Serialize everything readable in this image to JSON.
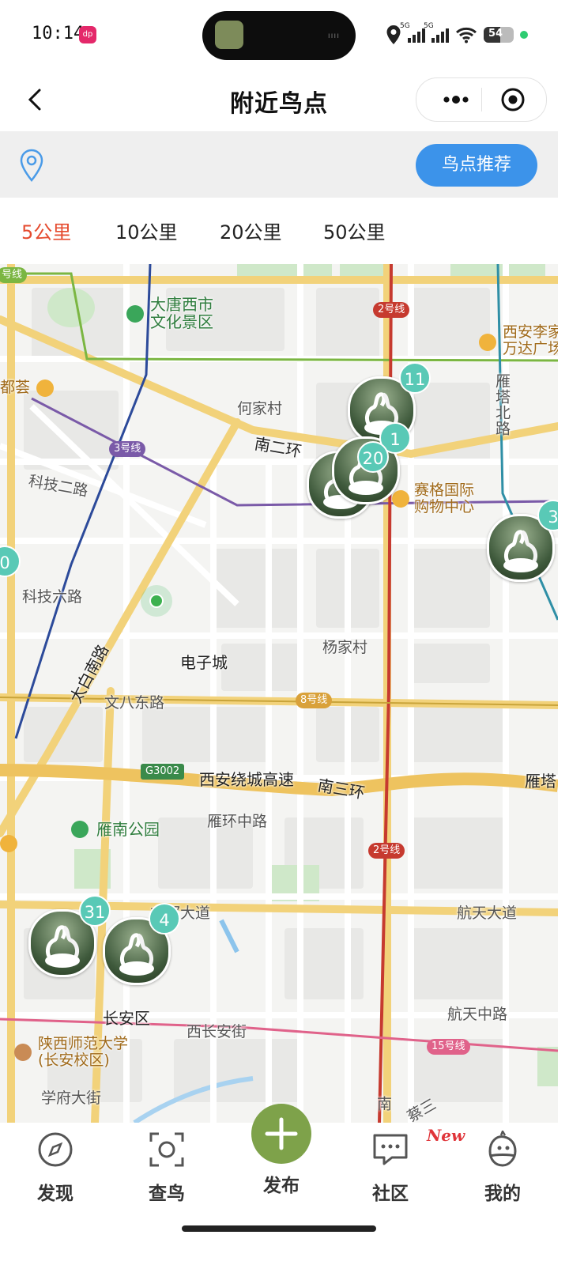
{
  "status": {
    "time": "10:14",
    "app_badge": "dp",
    "battery": "54",
    "net1": "5G",
    "net2": "5G"
  },
  "header": {
    "title": "附近鸟点"
  },
  "locbar": {
    "recommend_label": "鸟点推荐"
  },
  "tabs": [
    {
      "label": "5公里",
      "active": true
    },
    {
      "label": "10公里",
      "active": false
    },
    {
      "label": "20公里",
      "active": false
    },
    {
      "label": "50公里",
      "active": false
    }
  ],
  "map": {
    "labels": {
      "datang": "大唐西市\n文化景区",
      "wanda": "西安李家\n万达广场",
      "dufu": "都荟",
      "hejia": "何家村",
      "nan2": "南二环",
      "yanta_north": "雁塔北路",
      "keji2": "科技二路",
      "saige": "赛格国际\n购物中心",
      "keji6": "科技六路",
      "yangjia": "杨家村",
      "dianzi": "电子城",
      "taibai": "太白南路",
      "wenba": "文八东路",
      "raocheng": "西安绕城高速",
      "nan3": "南三环",
      "yanta": "雁塔",
      "yannan": "雁南公园",
      "yanhuan": "雁环中路",
      "gudu": "古都大道",
      "hangtian": "航天大道",
      "hangtianzhong": "航天中路",
      "changan": "长安区",
      "xichangan": "西长安街",
      "shifan": "陕西师范大学\n(长安校区)",
      "xuefu": "学府大街",
      "nan_partial": "南",
      "qin_partial": "蔡三"
    },
    "line_tags": {
      "l4": "号线",
      "l2a": "2号线",
      "l3": "3号线",
      "l8": "8号线",
      "l2b": "2号线",
      "l15": "15号线",
      "g3002": "G3002"
    },
    "spots": [
      {
        "count": "11"
      },
      {
        "count": "1"
      },
      {
        "count": "20"
      },
      {
        "count": "3"
      },
      {
        "count": "0"
      },
      {
        "count": "31"
      },
      {
        "count": "4"
      }
    ]
  },
  "nav": {
    "discover": "发现",
    "identify": "查鸟",
    "publish": "发布",
    "community": "社区",
    "community_tag": "New",
    "mine": "我的"
  },
  "colors": {
    "accent_blue": "#3c93ea",
    "active_tab": "#e54b2f",
    "publish_green": "#7ea24a",
    "cluster_teal": "#59c9b6"
  }
}
